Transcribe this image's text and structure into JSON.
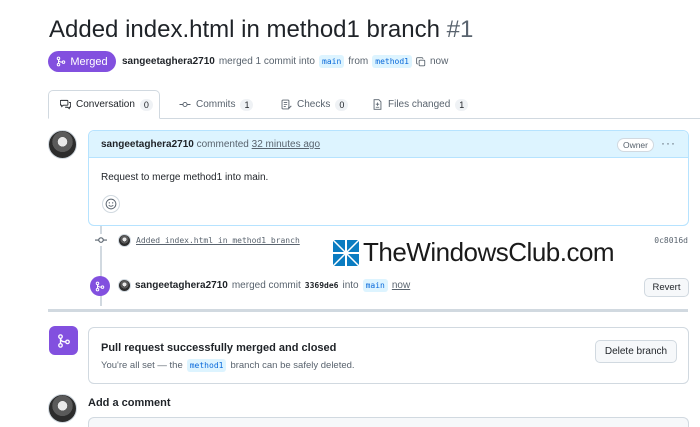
{
  "pr": {
    "title": "Added index.html in method1 branch",
    "number": "#1",
    "status": "Merged",
    "author": "sangeetaghera2710",
    "merge_text": "merged 1 commit into",
    "base_branch": "main",
    "from_text": "from",
    "head_branch": "method1",
    "time": "now"
  },
  "tabs": [
    {
      "label": "Conversation",
      "count": "0",
      "icon": "comment-discussion-icon"
    },
    {
      "label": "Commits",
      "count": "1",
      "icon": "git-commit-icon"
    },
    {
      "label": "Checks",
      "count": "0",
      "icon": "checklist-icon"
    },
    {
      "label": "Files changed",
      "count": "1",
      "icon": "file-diff-icon"
    }
  ],
  "comment": {
    "author": "sangeetaghera2710",
    "action": "commented",
    "time": "32 minutes ago",
    "role": "Owner",
    "body": "Request to merge method1 into main.",
    "menu": "···"
  },
  "commit": {
    "message": "Added index.html in method1 branch",
    "sha": "0c8016d"
  },
  "merge_event": {
    "author": "sangeetaghera2710",
    "text": "merged commit",
    "sha": "3369de6",
    "into": "into",
    "branch": "main",
    "time": "now",
    "revert_label": "Revert"
  },
  "merged_box": {
    "title": "Pull request successfully merged and closed",
    "desc_prefix": "You're all set — the",
    "branch": "method1",
    "desc_suffix": "branch can be safely deleted.",
    "delete_label": "Delete branch"
  },
  "add_comment": {
    "title": "Add a comment"
  },
  "watermark": {
    "text": "TheWindowsClub.com"
  },
  "colors": {
    "merged_purple": "#8250df",
    "link_blue": "#0969da",
    "comment_header_bg": "#ddf4ff"
  }
}
